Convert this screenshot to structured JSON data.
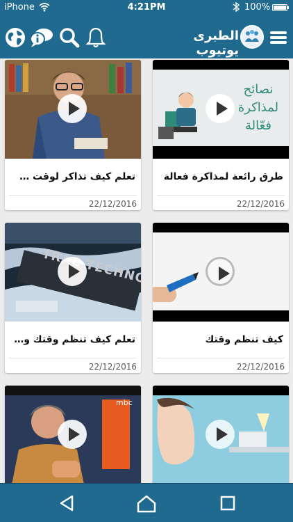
{
  "status_bar": {
    "carrier": "iPhone",
    "time": "4:21PM",
    "battery": "100%"
  },
  "app_bar": {
    "title": "الطبرى يوتيوب",
    "icons": [
      "globe-icon",
      "info-chat-icon",
      "search-icon",
      "bell-icon",
      "menu-icon"
    ]
  },
  "videos": [
    {
      "title": "طرق رائعة لمذاكرة فعالة",
      "date": "22/12/2016",
      "overlay_text": "نصائح لمذاكرة فعّالة"
    },
    {
      "title": "تعلم كيف تذاكر لوقت طويل",
      "date": "22/12/2016"
    },
    {
      "title": "كيف تنظم وقتك",
      "date": "22/12/2016"
    },
    {
      "title": "تعلم كيف تنظم وقتك وتست...",
      "date": "22/12/2016",
      "overlay_text": "TRAC TECHNO"
    },
    {
      "title": "",
      "date": ""
    },
    {
      "title": "",
      "date": "",
      "overlay_text": "mbc"
    }
  ],
  "nav_bar": {
    "buttons": [
      "back-icon",
      "home-icon",
      "recents-icon"
    ]
  },
  "colors": {
    "primary": "#1f6a8e",
    "background": "#ececec",
    "card": "#ffffff"
  }
}
